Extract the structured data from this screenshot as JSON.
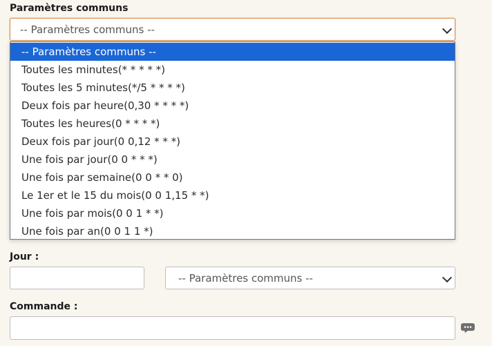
{
  "common_settings": {
    "label": "Paramètres communs",
    "selected": "-- Paramètres communs --",
    "options": [
      "-- Paramètres communs --",
      "Toutes les minutes(* * * * *)",
      "Toutes les 5 minutes(*/5 * * * *)",
      "Deux fois par heure(0,30 * * * *)",
      "Toutes les heures(0 * * * *)",
      "Deux fois par jour(0 0,12 * * *)",
      "Une fois par jour(0 0 * * *)",
      "Une fois par semaine(0 0 * * 0)",
      "Le 1er et le 15 du mois(0 0 1,15 * *)",
      "Une fois par mois(0 0 1 * *)",
      "Une fois par an(0 0 1 1 *)"
    ]
  },
  "day": {
    "label": "Jour :",
    "value": "",
    "select_value": "-- Paramètres communs --"
  },
  "command": {
    "label": "Commande :",
    "value": ""
  },
  "icons": {
    "chat": "chat-bubble-icon"
  },
  "colors": {
    "background": "#f9f5ef",
    "focus_border": "#d8914b",
    "selected_option": "#1a66d6"
  }
}
